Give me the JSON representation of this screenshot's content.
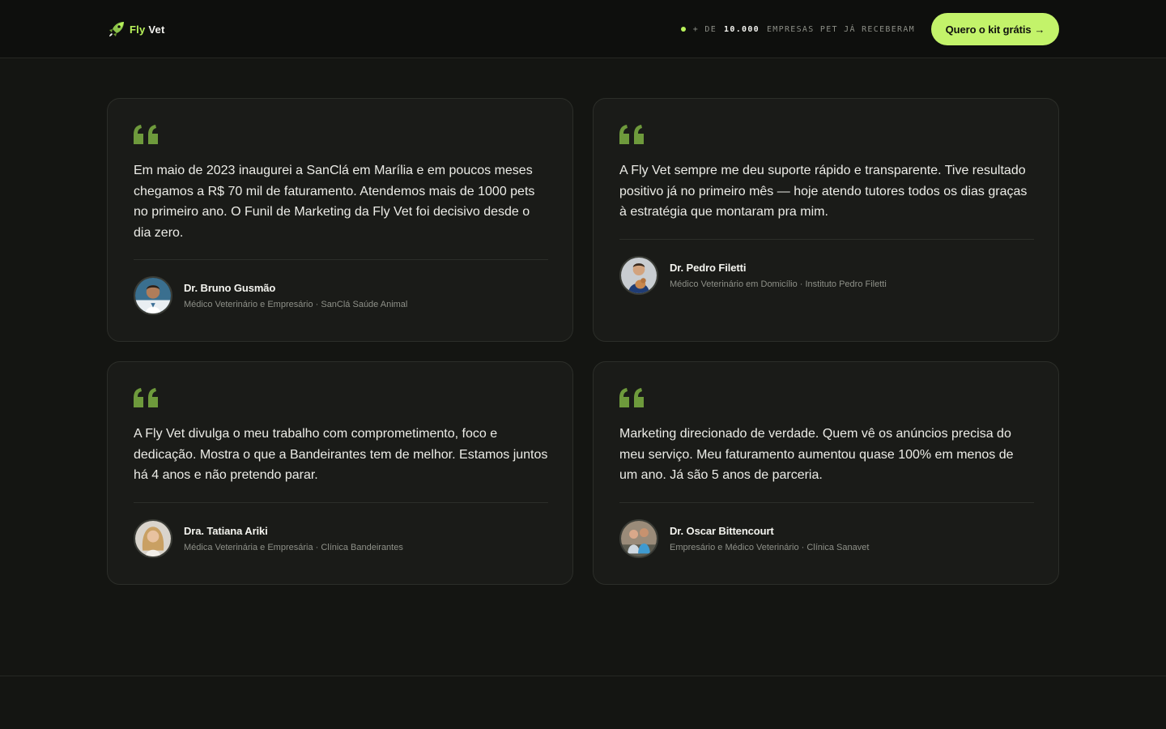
{
  "brand": {
    "name_part1": "Fly",
    "name_part2": "Vet",
    "accent": "#b8f25a",
    "logo_icon": "rocket-icon"
  },
  "header": {
    "stat_prefix": "+ DE",
    "stat_number": "10.000",
    "stat_suffix": "EMPRESAS PET JÁ RECEBERAM",
    "cta_label": "Quero o kit grátis",
    "cta_arrow": "→"
  },
  "testimonials": [
    {
      "text": "Em maio de 2023 inaugurei a SanClá em Marília e em poucos meses chegamos a R$ 70 mil de faturamento. Atendemos mais de 1000 pets no primeiro ano. O Funil de Marketing da Fly Vet foi decisivo desde o dia zero.",
      "name": "Dr. Bruno Gusmão",
      "role": "Médico Veterinário e Empresário · SanClá Saúde Animal"
    },
    {
      "text": "A Fly Vet sempre me deu suporte rápido e transparente. Tive resultado positivo já no primeiro mês — hoje atendo tutores todos os dias graças à estratégia que montaram pra mim.",
      "name": "Dr. Pedro Filetti",
      "role": "Médico Veterinário em Domicílio · Instituto Pedro Filetti"
    },
    {
      "text": "A Fly Vet divulga o meu trabalho com comprometimento, foco e dedicação. Mostra o que a Bandeirantes tem de melhor. Estamos juntos há 4 anos e não pretendo parar.",
      "name": "Dra. Tatiana Ariki",
      "role": "Médica Veterinária e Empresária · Clínica Bandeirantes"
    },
    {
      "text": "Marketing direcionado de verdade. Quem vê os anúncios precisa do meu serviço. Meu faturamento aumentou quase 100% em menos de um ano. Já são 5 anos de parceria.",
      "name": "Dr. Oscar Bittencourt",
      "role": "Empresário e Médico Veterinário · Clínica Sanavet"
    }
  ]
}
